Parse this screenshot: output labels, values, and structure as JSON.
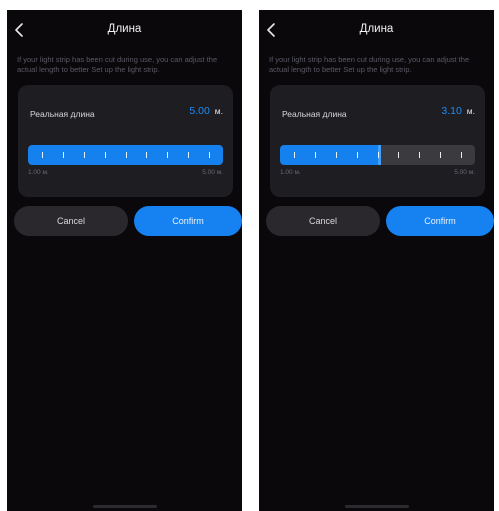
{
  "screens": [
    {
      "title": "Длина",
      "description": "If your light strip has been cut during use, you can adjust the actual length to better Set up the light strip.",
      "card": {
        "label": "Реальная длина",
        "value": "5.00",
        "unit": "м."
      },
      "slider": {
        "min_label": "1.00 м.",
        "max_label": "5.00 м.",
        "fill_fraction": 1.0
      },
      "buttons": {
        "cancel": "Cancel",
        "confirm": "Confirm"
      }
    },
    {
      "title": "Длина",
      "description": "If your light strip has been cut during use, you can adjust the actual length to better Set up the light strip.",
      "card": {
        "label": "Реальная длина",
        "value": "3.10",
        "unit": "м."
      },
      "slider": {
        "min_label": "1.00 м.",
        "max_label": "5.00 м.",
        "fill_fraction": 0.52
      },
      "buttons": {
        "cancel": "Cancel",
        "confirm": "Confirm"
      }
    }
  ],
  "colors": {
    "background": "#0b080c",
    "card": "#1e1d22",
    "accent": "#1581ee",
    "value_text": "#1e8cf3"
  }
}
